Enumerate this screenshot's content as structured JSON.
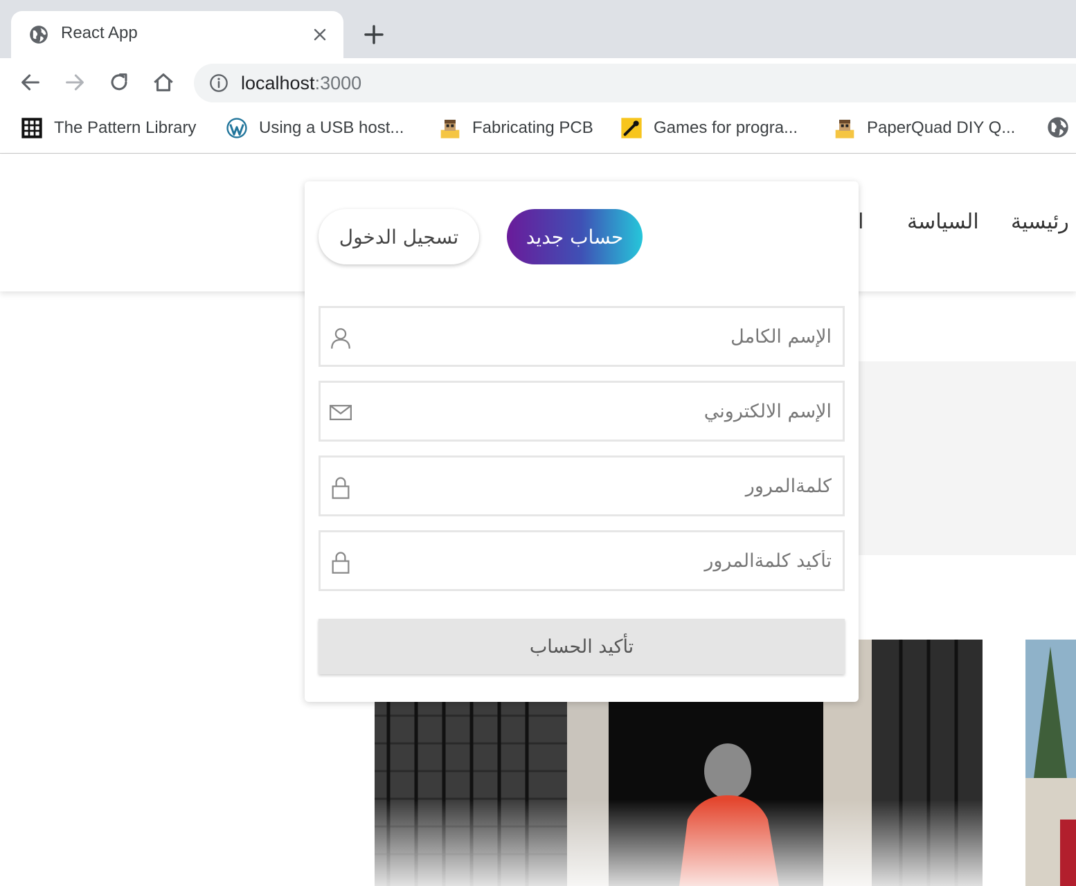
{
  "browser": {
    "tab_title": "React App",
    "url_host": "localhost",
    "url_port": ":3000",
    "bookmarks": [
      {
        "label": "The Pattern Library",
        "icon": "grid-icon"
      },
      {
        "label": "Using a USB host...",
        "icon": "wordpress-icon"
      },
      {
        "label": "Fabricating PCB",
        "icon": "pixel-avatar-icon"
      },
      {
        "label": "Games for progra...",
        "icon": "yellow-game-icon"
      },
      {
        "label": "PaperQuad DIY Q...",
        "icon": "pixel-avatar-icon"
      }
    ]
  },
  "nav": {
    "items": [
      "رئيسية",
      "السياسة",
      "الا"
    ]
  },
  "auth_modal": {
    "login_tab": "تسجيل الدخول",
    "signup_tab": "حساب جديد",
    "fields": {
      "full_name_placeholder": "الإسم الكامل",
      "email_placeholder": "الإسم الالكتروني",
      "password_placeholder": "كلمةالمرور",
      "confirm_password_placeholder": "تأكيد كلمةالمرور"
    },
    "submit_label": "تأكيد الحساب",
    "accent_colors": [
      "#6a1b9a",
      "#3f51b5",
      "#26c6da"
    ]
  }
}
